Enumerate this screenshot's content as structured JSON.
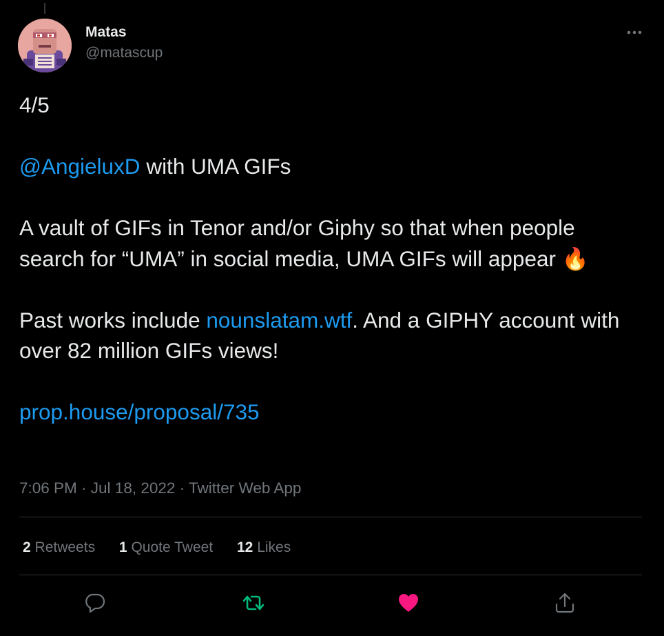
{
  "author": {
    "display_name": "Matas",
    "handle": "@matascup"
  },
  "tweet": {
    "line1": "4/5",
    "mention": "@AngieluxD",
    "line2_rest": " with UMA GIFs",
    "para3": "A vault of GIFs in Tenor and/or Giphy so that when people search for “UMA” in social media, UMA GIFs will appear 🔥",
    "para4_start": "Past works include ",
    "para4_link": "nounslatam.wtf",
    "para4_end": ". And a GIPHY account with over 82 million GIFs views!",
    "url": "prop.house/proposal/735"
  },
  "meta": {
    "time": "7:06 PM",
    "separator": " · ",
    "date": "Jul 18, 2022",
    "source": "Twitter Web App"
  },
  "stats": {
    "retweets_count": "2",
    "retweets_label": "Retweets",
    "quotes_count": "1",
    "quotes_label": "Quote Tweet",
    "likes_count": "12",
    "likes_label": "Likes"
  },
  "icons": {
    "more": "more-horizontal-icon",
    "reply": "reply-bubble-icon",
    "retweet": "retweet-icon",
    "like": "heart-filled-icon",
    "share": "share-upload-icon"
  },
  "colors": {
    "background": "#000000",
    "text": "#e7e9ea",
    "secondary": "#71767b",
    "link": "#1d9bf0",
    "retweet_active": "#00ba7c",
    "like_active": "#f91880",
    "divider": "#2f3336"
  }
}
